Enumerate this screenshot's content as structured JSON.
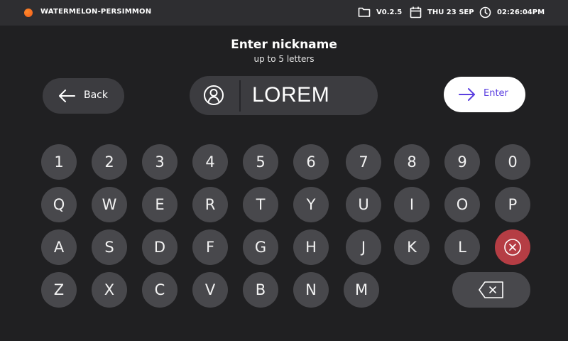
{
  "topbar": {
    "app_name": "WATERMELON-PERSIMMON",
    "version": "V0.2.5",
    "date": "THU 23 SEP",
    "time": "02:26:04PM",
    "version_icon": "folder-icon",
    "date_icon": "calendar-icon",
    "time_icon": "clock-icon",
    "accent_color": "#f26a22"
  },
  "header": {
    "title": "Enter nickname",
    "subtitle": "up to 5 letters"
  },
  "actions": {
    "back_label": "Back",
    "enter_label": "Enter",
    "enter_color": "#5b3fe0"
  },
  "nickname": {
    "value": "LOREM",
    "icon": "user-icon"
  },
  "keyboard": {
    "row1": [
      "1",
      "2",
      "3",
      "4",
      "5",
      "6",
      "7",
      "8",
      "9",
      "0"
    ],
    "row2": [
      "Q",
      "W",
      "E",
      "R",
      "T",
      "Y",
      "U",
      "I",
      "O",
      "P"
    ],
    "row3": [
      "A",
      "S",
      "D",
      "F",
      "G",
      "H",
      "J",
      "K",
      "L"
    ],
    "row4": [
      "Z",
      "X",
      "C",
      "V",
      "B",
      "N",
      "M"
    ],
    "clear_icon": "clear-circle-icon",
    "clear_color": "#b53d44",
    "backspace_icon": "backspace-icon"
  }
}
